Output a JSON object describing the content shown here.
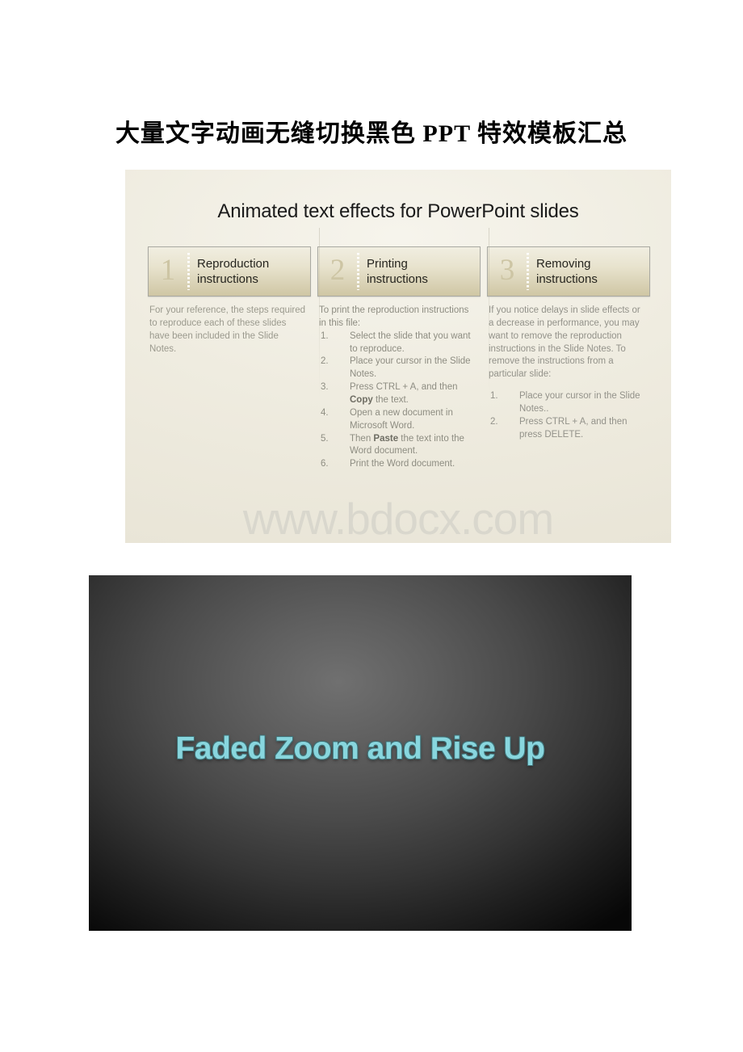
{
  "document": {
    "title": "大量文字动画无缝切换黑色 PPT 特效模板汇总"
  },
  "figure_one": {
    "slide_title": "Animated text effects for PowerPoint slides",
    "watermark": "www.bdocx.com",
    "columns": [
      {
        "number": "1",
        "label_line1": "Reproduction",
        "label_line2": "instructions",
        "intro": "For your reference, the steps required to reproduce each of these slides have been included in the Slide Notes.",
        "steps": []
      },
      {
        "number": "2",
        "label_line1": "Printing",
        "label_line2": "instructions",
        "intro": "To print the reproduction instructions in this file:",
        "steps": [
          {
            "marker": "1.",
            "text": "Select the slide that you want to reproduce."
          },
          {
            "marker": "2.",
            "text": "Place your cursor in the Slide Notes."
          },
          {
            "marker": "3.",
            "text": "Press CTRL + A, and then ",
            "bold": "Copy",
            "text_after": " the text."
          },
          {
            "marker": "4.",
            "text": "Open a new document in Microsoft Word."
          },
          {
            "marker": "5.",
            "text": "Then ",
            "bold": "Paste",
            "text_after": " the text into the Word document."
          },
          {
            "marker": "6.",
            "text": "Print the Word document."
          }
        ]
      },
      {
        "number": "3",
        "label_line1": "Removing",
        "label_line2": "instructions",
        "intro": "If you notice delays in slide effects or a decrease in performance, you may want to remove the reproduction instructions in the Slide Notes. To remove the instructions from a particular slide:",
        "steps": [
          {
            "marker": "1.",
            "text": "Place your cursor in the Slide Notes.."
          },
          {
            "marker": "2.",
            "text": "Press CTRL + A, and then press DELETE."
          }
        ]
      }
    ]
  },
  "figure_two": {
    "slide_title": "Faded Zoom and Rise Up",
    "text_color": "#88d6de",
    "background_center": "#707070",
    "background_edge": "#070707"
  }
}
